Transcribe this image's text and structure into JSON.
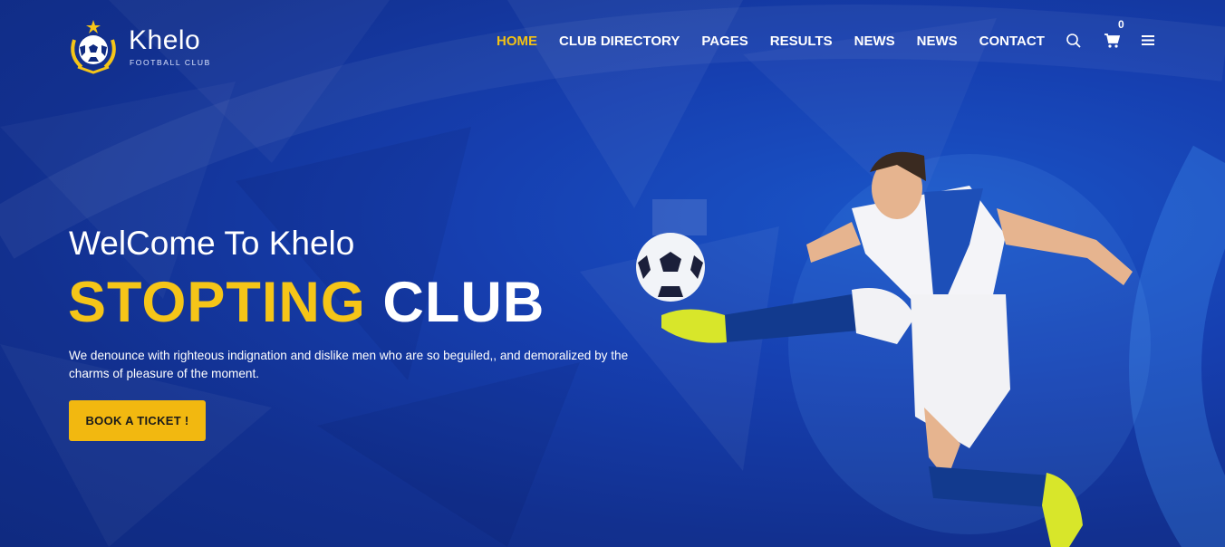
{
  "brand": {
    "name": "Khelo",
    "tagline": "FOOTBALL CLUB"
  },
  "nav": {
    "items": [
      {
        "label": "HOME",
        "active": true
      },
      {
        "label": "CLUB DIRECTORY",
        "active": false
      },
      {
        "label": "PAGES",
        "active": false
      },
      {
        "label": "RESULTS",
        "active": false
      },
      {
        "label": "NEWS",
        "active": false
      },
      {
        "label": "NEWS",
        "active": false
      },
      {
        "label": "CONTACT",
        "active": false
      }
    ],
    "search_icon": "search-icon",
    "cart_icon": "cart-icon",
    "cart_count": "0",
    "menu_icon": "hamburger-menu-icon"
  },
  "hero": {
    "welcome": "WelCome To Khelo",
    "title_accent": "STOPTING",
    "title_rest": "CLUB",
    "description": "We denounce with righteous indignation and dislike men who are so beguiled,, and demoralized by the charms of pleasure of the moment.",
    "cta_label": "BOOK A TICKET !"
  },
  "colors": {
    "accent": "#f5c518",
    "background": "#163fb0",
    "button": "#f2b810",
    "text": "#ffffff"
  }
}
